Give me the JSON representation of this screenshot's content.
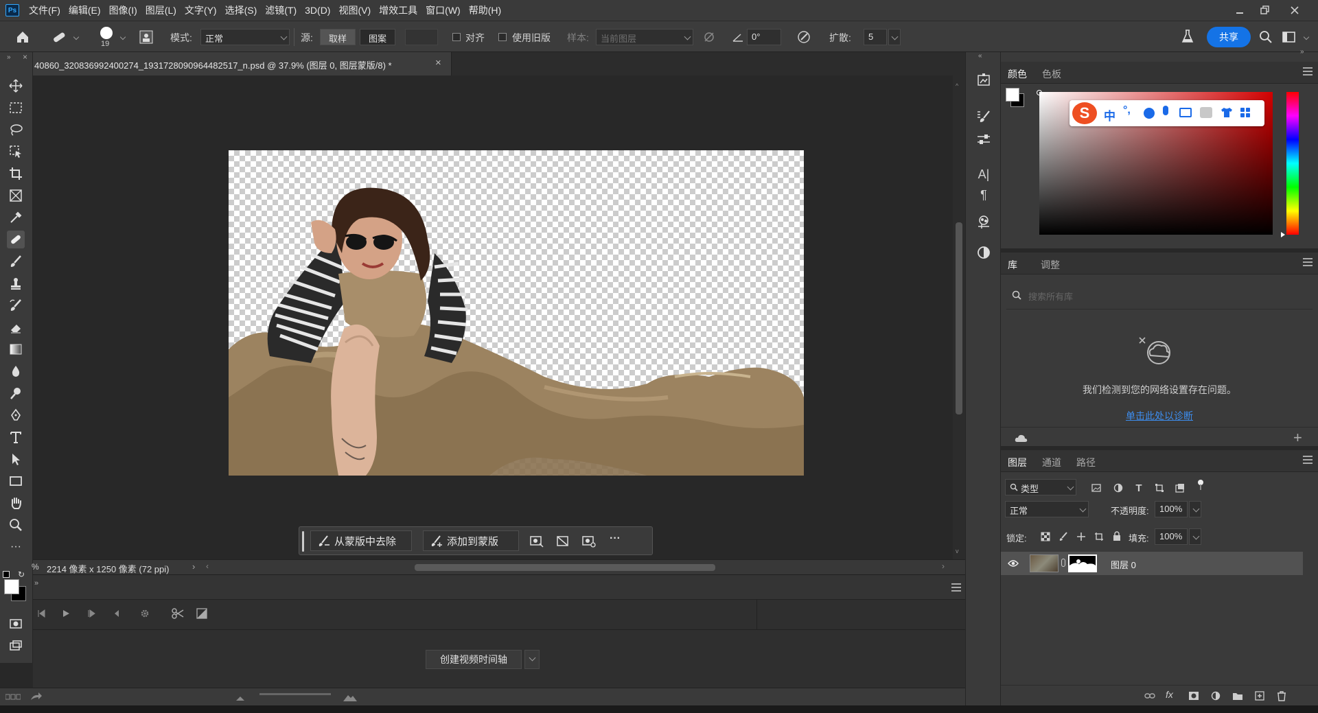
{
  "app": {
    "logo": "Ps"
  },
  "menu": [
    "文件(F)",
    "编辑(E)",
    "图像(I)",
    "图层(L)",
    "文字(Y)",
    "选择(S)",
    "滤镜(T)",
    "3D(D)",
    "视图(V)",
    "增效工具",
    "窗口(W)",
    "帮助(H)"
  ],
  "options": {
    "brush_size": "19",
    "mode_label": "模式:",
    "mode_value": "正常",
    "source_label": "源:",
    "source_sample": "取样",
    "source_pattern": "图案",
    "align_label": "对齐",
    "legacy_label": "使用旧版",
    "sample_label": "样本:",
    "sample_value": "当前图层",
    "angle_value": "0°",
    "diffusion_label": "扩散:",
    "diffusion_value": "5",
    "share_label": "共享"
  },
  "document": {
    "tab_title": "40860_320836992400274_1931728090964482517_n.psd @ 37.9% (图层 0, 图层蒙版/8) *",
    "close": "×"
  },
  "context_bar": {
    "remove_label": "从蒙版中去除",
    "add_label": "添加到蒙版",
    "more": "···"
  },
  "status": {
    "zoom": "%",
    "dimensions": "2214 像素 x 1250 像素 (72 ppi)",
    "arrow": "›"
  },
  "timeline": {
    "create_label": "创建视频时间轴"
  },
  "color_panel": {
    "tabs": [
      "颜色",
      "色板"
    ],
    "accent_colors": {
      "hue_top": "#ff0000",
      "picker_red": "#d40000"
    },
    "ime": {
      "logo": "S",
      "chinese": "中",
      "punct": "°,"
    }
  },
  "libraries_panel": {
    "tabs": [
      "库",
      "调整"
    ],
    "search_placeholder": "搜索所有库",
    "network_message": "我们检测到您的网络设置存在问题。",
    "diagnose_link": "单击此处以诊断"
  },
  "layers_panel": {
    "tabs": [
      "图层",
      "通道",
      "路径"
    ],
    "filter_label": "类型",
    "blend_mode": "正常",
    "opacity_label": "不透明度:",
    "opacity_value": "100%",
    "lock_label": "锁定:",
    "fill_label": "填充:",
    "fill_value": "100%",
    "layers": [
      {
        "name": "图层 0",
        "visible": true
      }
    ],
    "fx_label": "fx"
  }
}
